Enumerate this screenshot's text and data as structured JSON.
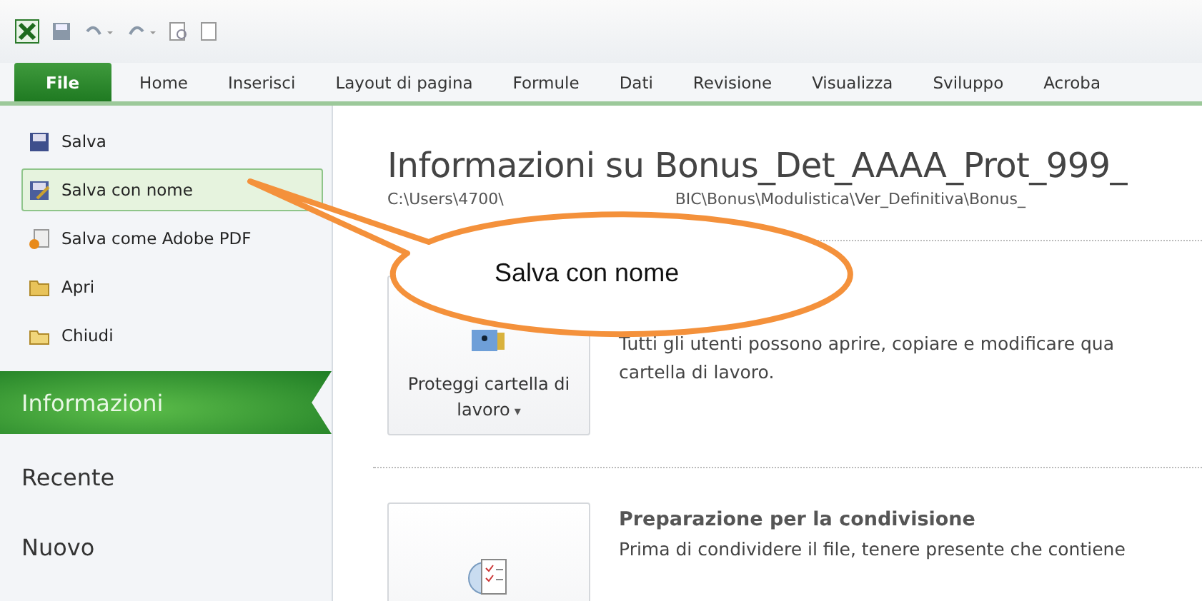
{
  "quick_access": {
    "items": [
      {
        "kind": "excel"
      },
      {
        "kind": "save"
      },
      {
        "kind": "undo"
      },
      {
        "kind": "redo"
      },
      {
        "kind": "preview"
      },
      {
        "kind": "new"
      }
    ]
  },
  "ribbon_tabs": [
    {
      "label": "File",
      "selected": true
    },
    {
      "label": "Home",
      "selected": false
    },
    {
      "label": "Inserisci",
      "selected": false
    },
    {
      "label": "Layout di pagina",
      "selected": false
    },
    {
      "label": "Formule",
      "selected": false
    },
    {
      "label": "Dati",
      "selected": false
    },
    {
      "label": "Revisione",
      "selected": false
    },
    {
      "label": "Visualizza",
      "selected": false
    },
    {
      "label": "Sviluppo",
      "selected": false
    },
    {
      "label": "Acroba",
      "selected": false
    }
  ],
  "sidebar": {
    "commands": [
      {
        "label": "Salva",
        "selected": false
      },
      {
        "label": "Salva con nome",
        "selected": true
      },
      {
        "label": "Salva come Adobe PDF",
        "selected": false
      },
      {
        "label": "Apri",
        "selected": false
      },
      {
        "label": "Chiudi",
        "selected": false
      }
    ],
    "sections": [
      {
        "label": "Informazioni",
        "selected": true
      },
      {
        "label": "Recente",
        "selected": false
      },
      {
        "label": "Nuovo",
        "selected": false
      }
    ]
  },
  "info": {
    "title": "Informazioni su Bonus_Det_AAAA_Prot_999_",
    "path_start": "C:\\Users\\4700\\",
    "path_end": "BIC\\Bonus\\Modulistica\\Ver_Definitiva\\Bonus_",
    "sections": [
      {
        "button": "Proteggi cartella di lavoro",
        "caret": "▾",
        "text": "Tutti gli utenti possono aprire, copiare e modificare qua",
        "text2": "cartella di lavoro."
      },
      {
        "heading": "Preparazione per la condivisione",
        "text": "Prima di condividere il file, tenere presente che contiene"
      }
    ]
  },
  "callout": {
    "text": "Salva con nome"
  }
}
